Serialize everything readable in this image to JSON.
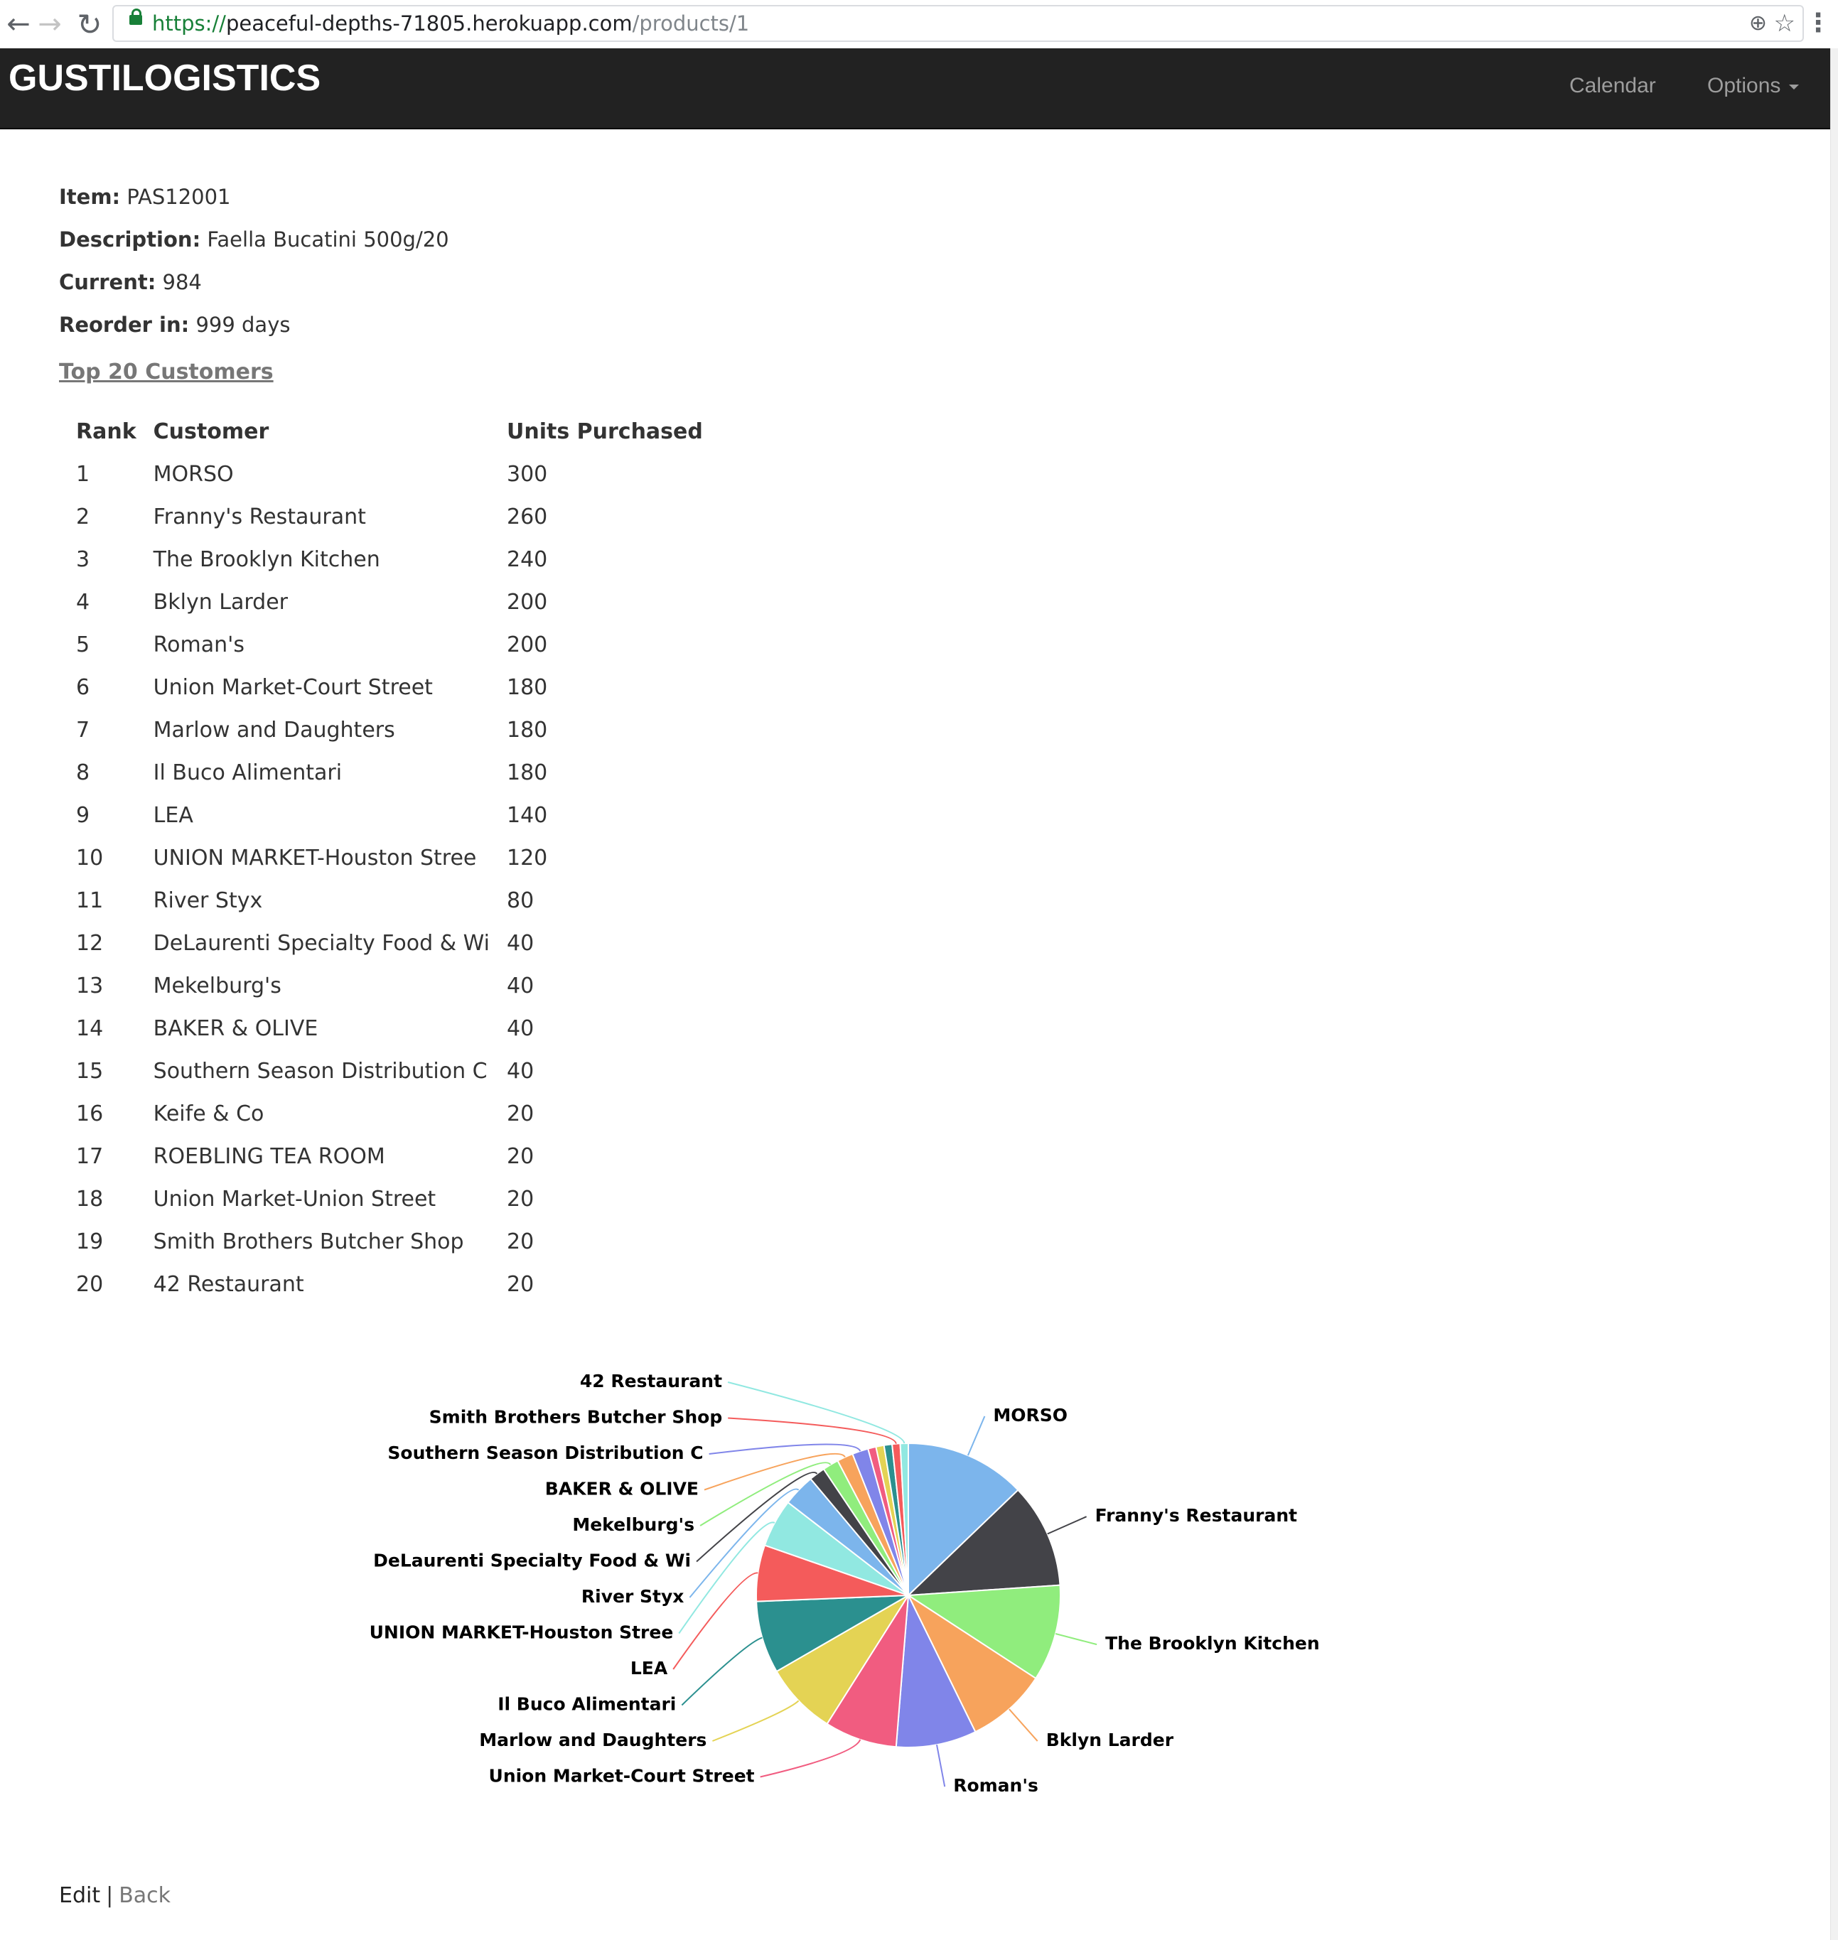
{
  "browser": {
    "url_scheme": "https://",
    "url_host": "peaceful-depths-71805.herokuapp.com",
    "url_path": "/products/1",
    "back_icon": "arrow-left",
    "forward_icon": "arrow-right",
    "reload_icon": "reload",
    "zoom_icon": "magnifier",
    "star_icon": "star",
    "menu_icon": "vertical-dots"
  },
  "navbar": {
    "brand": "GUSTILOGISTICS",
    "calendar_label": "Calendar",
    "options_label": "Options",
    "background": "#222222"
  },
  "product": {
    "item_label": "Item:",
    "item_value": "PAS12001",
    "description_label": "Description:",
    "description_value": "Faella Bucatini 500g/20",
    "current_label": "Current:",
    "current_value": "984",
    "reorder_label": "Reorder in:",
    "reorder_value": "999 days"
  },
  "top_customers_link": "Top 20 Customers",
  "table": {
    "headers": [
      "Rank",
      "Customer",
      "Units Purchased"
    ],
    "rows": [
      [
        "1",
        "MORSO",
        "300"
      ],
      [
        "2",
        "Franny's Restaurant",
        "260"
      ],
      [
        "3",
        "The Brooklyn Kitchen",
        "240"
      ],
      [
        "4",
        "Bklyn Larder",
        "200"
      ],
      [
        "5",
        "Roman's",
        "200"
      ],
      [
        "6",
        "Union Market-Court Street",
        "180"
      ],
      [
        "7",
        "Marlow and Daughters",
        "180"
      ],
      [
        "8",
        "Il Buco Alimentari",
        "180"
      ],
      [
        "9",
        "LEA",
        "140"
      ],
      [
        "10",
        "UNION MARKET-Houston Stree",
        "120"
      ],
      [
        "11",
        "River Styx",
        "80"
      ],
      [
        "12",
        "DeLaurenti Specialty Food & Wi",
        "40"
      ],
      [
        "13",
        "Mekelburg's",
        "40"
      ],
      [
        "14",
        "BAKER & OLIVE",
        "40"
      ],
      [
        "15",
        "Southern Season Distribution C",
        "40"
      ],
      [
        "16",
        "Keife & Co",
        "20"
      ],
      [
        "17",
        "ROEBLING TEA ROOM",
        "20"
      ],
      [
        "18",
        "Union Market-Union Street",
        "20"
      ],
      [
        "19",
        "Smith Brothers Butcher Shop",
        "20"
      ],
      [
        "20",
        "42 Restaurant",
        "20"
      ]
    ]
  },
  "chart_data": {
    "type": "pie",
    "categories": [
      "MORSO",
      "Franny's Restaurant",
      "The Brooklyn Kitchen",
      "Bklyn Larder",
      "Roman's",
      "Union Market-Court Street",
      "Marlow and Daughters",
      "Il Buco Alimentari",
      "LEA",
      "UNION MARKET-Houston Stree",
      "River Styx",
      "DeLaurenti Specialty Food & Wi",
      "Mekelburg's",
      "BAKER & OLIVE",
      "Southern Season Distribution C",
      "Keife & Co",
      "ROEBLING TEA ROOM",
      "Union Market-Union Street",
      "Smith Brothers Butcher Shop",
      "42 Restaurant"
    ],
    "values": [
      300,
      260,
      240,
      200,
      200,
      180,
      180,
      180,
      140,
      120,
      80,
      40,
      40,
      40,
      40,
      20,
      20,
      20,
      20,
      20
    ],
    "colors": [
      "#7cb5ec",
      "#434348",
      "#90ed7d",
      "#f7a35c",
      "#8085e9",
      "#f15c80",
      "#e4d354",
      "#2b908f",
      "#f45b5b",
      "#91e8e1",
      "#7cb5ec",
      "#434348",
      "#90ed7d",
      "#f7a35c",
      "#8085e9",
      "#f15c80",
      "#e4d354",
      "#2b908f",
      "#f45b5b",
      "#91e8e1"
    ],
    "shown_labels": [
      true,
      true,
      true,
      true,
      true,
      true,
      true,
      true,
      true,
      true,
      true,
      true,
      true,
      true,
      true,
      false,
      false,
      false,
      true,
      true
    ]
  },
  "footer": {
    "edit_label": "Edit",
    "separator": "|",
    "back_label": "Back"
  }
}
